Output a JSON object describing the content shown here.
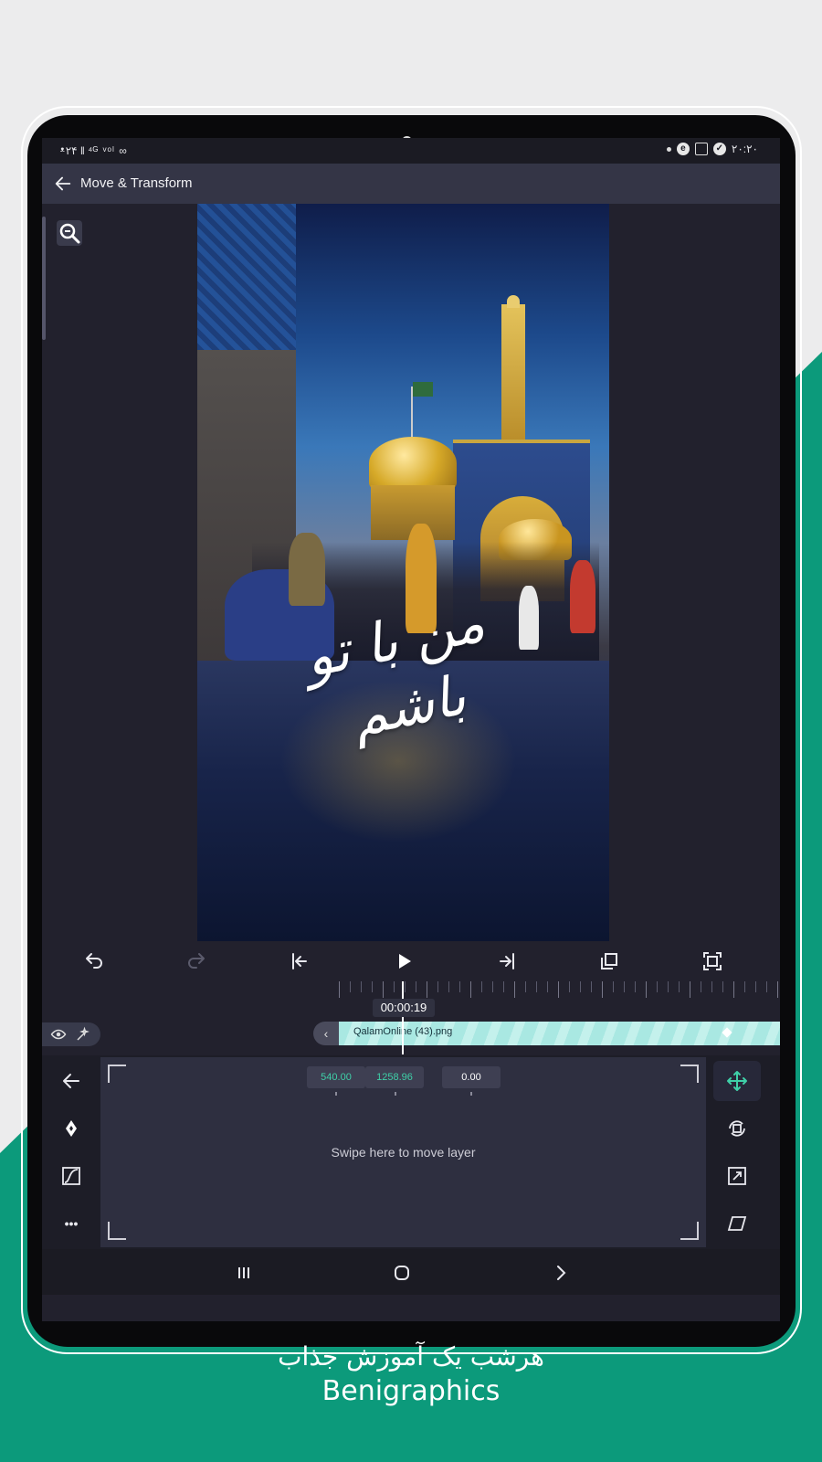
{
  "status_bar": {
    "left_text": "ᵜ۲۴ ‖ ⁴ᴳ ᵛᵒˡ ∞",
    "right_time": "۲۰:۲۰"
  },
  "app_bar": {
    "title": "Move & Transform",
    "back_icon": "arrow-left-icon"
  },
  "preview": {
    "zoom_icon": "zoom-icon",
    "overlay_text": "من با تو باشم"
  },
  "playback": {
    "icons": [
      "undo-icon",
      "redo-icon",
      "skip-start-icon",
      "play-icon",
      "skip-end-icon",
      "copy-frame-icon",
      "fullscreen-icon"
    ]
  },
  "timeline": {
    "timecode": "00:00:19",
    "clip_label": "QalamOnline (43).png",
    "clip_handle": "‹"
  },
  "panel": {
    "position_x": "540.00",
    "position_y": "1258.96",
    "rotation": "0.00",
    "swipe_hint": "Swipe here to move layer",
    "left_rail": [
      "back-icon",
      "keyframe-icon",
      "easing-icon",
      "more-icon"
    ],
    "right_tools": [
      "move-icon",
      "rotate-icon",
      "scale-icon",
      "skew-icon"
    ],
    "more_label": "•••"
  },
  "nav": {
    "icons": [
      "recents-icon",
      "home-icon",
      "back-chevron-icon"
    ]
  },
  "caption": {
    "persian": "هرشب یک آموزش جذاب",
    "english": "Benigraphics"
  },
  "colors": {
    "accent_green": "#0c9a7b",
    "teal_value": "#3fd0a8",
    "clip_color": "#a9e8e2",
    "panel_bg": "#2e2f40"
  }
}
